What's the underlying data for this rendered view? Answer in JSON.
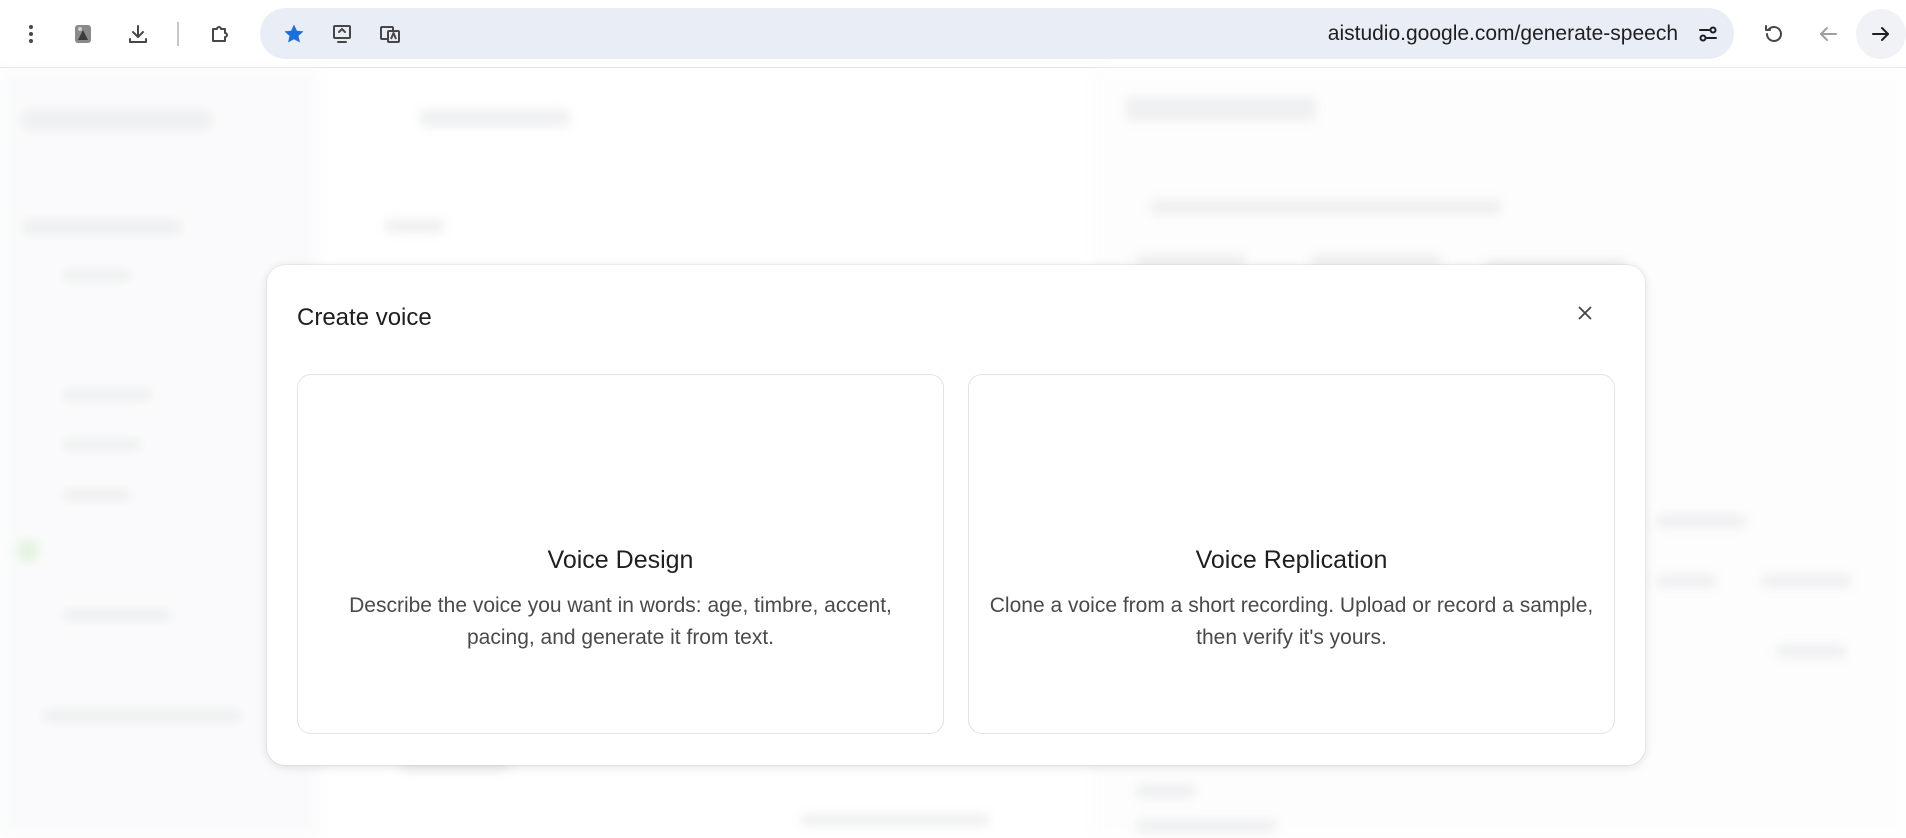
{
  "browser": {
    "url": "aistudio.google.com/generate-speech",
    "bookmark_color": "#1a6fe0"
  },
  "dialog": {
    "title": "Create voice",
    "options": [
      {
        "title": "Voice Design",
        "description": "Describe the voice you want in words: age, timbre, accent, pacing, and generate it from text."
      },
      {
        "title": "Voice Replication",
        "description": "Clone a voice from a short recording. Upload or record a sample, then verify it's yours."
      }
    ]
  }
}
